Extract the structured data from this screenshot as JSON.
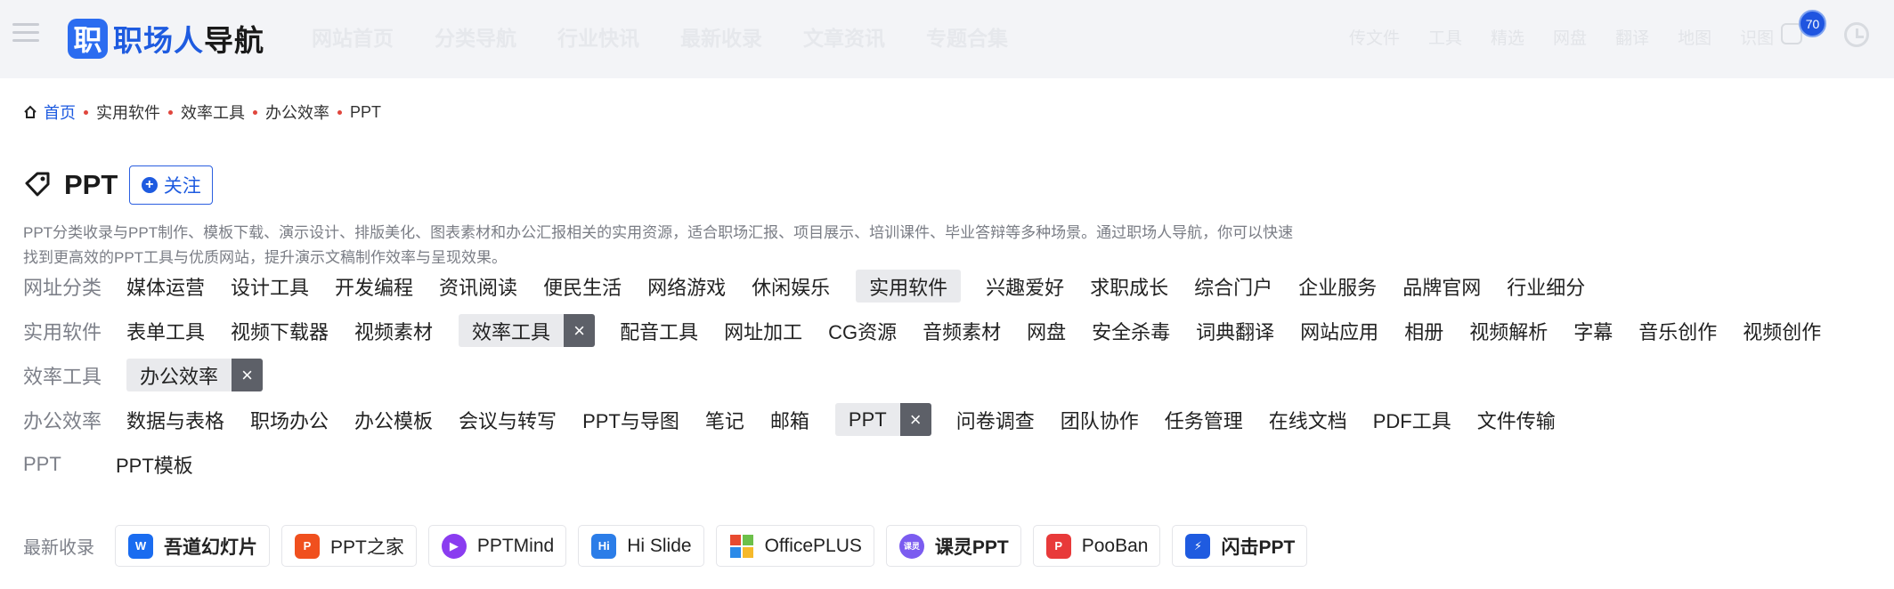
{
  "header": {
    "logo_mark": "职",
    "logo_text_a": "职场人",
    "logo_text_b": "导航",
    "nav": [
      "网站首页",
      "分类导航",
      "行业快讯",
      "最新收录",
      "文章资讯",
      "专题合集"
    ],
    "right_nav": [
      "传文件",
      "工具",
      "精选",
      "网盘",
      "翻译",
      "地图",
      "识图"
    ],
    "badge_count": "70"
  },
  "breadcrumb": [
    "首页",
    "实用软件",
    "效率工具",
    "办公效率",
    "PPT"
  ],
  "page": {
    "title": "PPT",
    "follow_label": "关注",
    "description": "PPT分类收录与PPT制作、模板下载、演示设计、排版美化、图表素材和办公汇报相关的实用资源，适合职场汇报、项目展示、培训课件、毕业答辩等多种场景。通过职场人导航，你可以快速找到更高效的PPT工具与优质网站，提升演示文稿制作效率与呈现效果。"
  },
  "filters": [
    {
      "label": "网址分类",
      "items": [
        "媒体运营",
        "设计工具",
        "开发编程",
        "资讯阅读",
        "便民生活",
        "网络游戏",
        "休闲娱乐",
        "实用软件",
        "兴趣爱好",
        "求职成长",
        "综合门户",
        "企业服务",
        "品牌官网",
        "行业细分"
      ],
      "selected": "实用软件"
    },
    {
      "label": "实用软件",
      "items": [
        "表单工具",
        "视频下载器",
        "视频素材",
        "效率工具",
        "配音工具",
        "网址加工",
        "CG资源",
        "音频素材",
        "网盘",
        "安全杀毒",
        "词典翻译",
        "网站应用",
        "相册",
        "视频解析",
        "字幕",
        "音乐创作",
        "视频创作"
      ],
      "selected": "效率工具"
    },
    {
      "label": "效率工具",
      "items": [
        "办公效率"
      ],
      "selected": "办公效率"
    },
    {
      "label": "办公效率",
      "items": [
        "数据与表格",
        "职场办公",
        "办公模板",
        "会议与转写",
        "PPT与导图",
        "笔记",
        "邮箱",
        "PPT",
        "问卷调查",
        "团队协作",
        "任务管理",
        "在线文档",
        "PDF工具",
        "文件传输"
      ],
      "selected": "PPT"
    },
    {
      "label": "PPT",
      "items": [
        "PPT模板"
      ],
      "selected": ""
    }
  ],
  "recent": {
    "label": "最新收录",
    "sites": [
      {
        "name": "吾道幻灯片",
        "icon": "wudao-logo-icon",
        "color": "#1a6cf0",
        "glyph": "W",
        "bold": true
      },
      {
        "name": "PPT之家",
        "icon": "pptzhijia-logo-icon",
        "color": "#f0501e",
        "glyph": "P",
        "bold": false
      },
      {
        "name": "PPTMind",
        "icon": "pptmind-logo-icon",
        "color": "#8a3cf0",
        "glyph": "▶",
        "bold": false
      },
      {
        "name": "Hi Slide",
        "icon": "hislide-logo-icon",
        "color": "#2b7de8",
        "glyph": "Hi",
        "bold": false
      },
      {
        "name": "OfficePLUS",
        "icon": "officeplus-logo-icon",
        "color": "#f2a61f",
        "glyph": "",
        "bold": false
      },
      {
        "name": "课灵PPT",
        "icon": "keling-logo-icon",
        "color": "#7b5cf0",
        "glyph": "课灵",
        "bold": true
      },
      {
        "name": "PooBan",
        "icon": "pooban-logo-icon",
        "color": "#e83a3a",
        "glyph": "P",
        "bold": false
      },
      {
        "name": "闪击PPT",
        "icon": "shanji-logo-icon",
        "color": "#1f5be0",
        "glyph": "⚡",
        "bold": true
      }
    ]
  }
}
